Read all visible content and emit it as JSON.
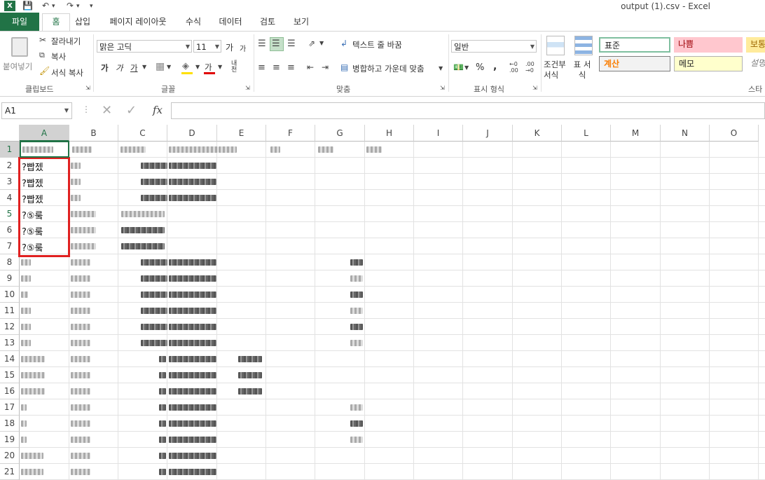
{
  "app": {
    "logo": "X",
    "title": "output (1).csv - Excel"
  },
  "tabs": [
    "파일",
    "홈",
    "삽입",
    "페이지 레이아웃",
    "수식",
    "데이터",
    "검토",
    "보기"
  ],
  "ribbon": {
    "clipboard": {
      "paste": "붙여넣기",
      "cut": "잘라내기",
      "copy": "복사",
      "format_painter": "서식 복사",
      "group": "클립보드"
    },
    "font": {
      "name": "맑은 고딕",
      "size": "11",
      "grow": "가",
      "shrink": "가",
      "bold": "가",
      "italic": "가",
      "underline": "가",
      "font_color_glyph": "가",
      "phonetic": "내천",
      "group": "글꼴"
    },
    "alignment": {
      "wrap": "텍스트 줄 바꿈",
      "merge": "병합하고 가운데 맞춤",
      "group": "맞춤"
    },
    "number": {
      "format": "일반",
      "percent": "%",
      "comma": ",",
      "group": "표시 형식"
    },
    "styles": {
      "conditional": "조건부 서식",
      "table": "표 서식",
      "normal": "표준",
      "bad": "나쁨",
      "neutral": "보통",
      "calc": "계산",
      "note": "메모",
      "explain": "설명",
      "group": "스타"
    }
  },
  "formula_bar": {
    "name_box": "A1",
    "fx": "fx",
    "value": ""
  },
  "columns": [
    "A",
    "B",
    "C",
    "D",
    "E",
    "F",
    "G",
    "H",
    "I",
    "J",
    "K",
    "L",
    "M",
    "N",
    "O"
  ],
  "rows": [
    "1",
    "2",
    "3",
    "4",
    "5",
    "6",
    "7",
    "8",
    "9",
    "10",
    "11",
    "12",
    "13",
    "14",
    "15",
    "16",
    "17",
    "18",
    "19",
    "20",
    "21"
  ],
  "column_a_visible": [
    "?빱젰",
    "?빱젰",
    "?빱젰",
    "?⑤뤀",
    "?⑤뤀",
    "?⑤뤀"
  ],
  "colors": {
    "accent": "#217346",
    "highlight_box": "#e02020"
  }
}
